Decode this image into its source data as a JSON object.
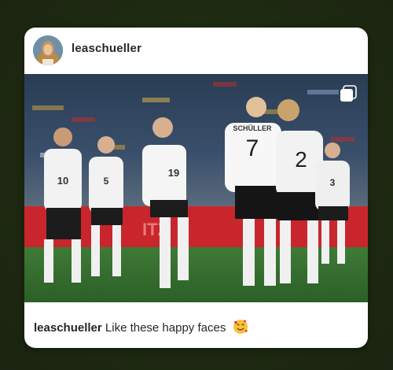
{
  "post": {
    "username": "leaschueller",
    "caption": {
      "username": "leaschueller",
      "text": "Like these happy faces"
    },
    "icons": {
      "avatar": "profile-photo",
      "multi": "multiple-photos-icon",
      "emoji": "smiling-face-with-hearts"
    },
    "photo": {
      "player_names": [
        "SCHÜLLER"
      ],
      "jersey_numbers": [
        "10",
        "5",
        "19",
        "7",
        "2",
        "3"
      ],
      "banner_text": "ITZ"
    }
  }
}
